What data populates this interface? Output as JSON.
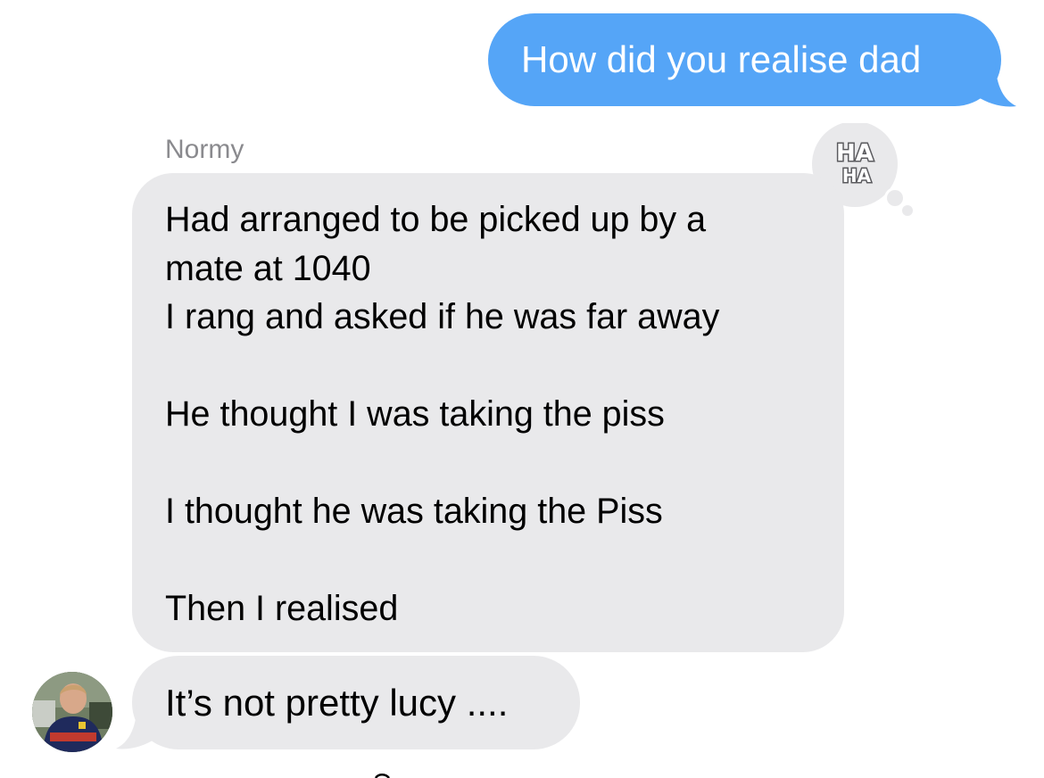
{
  "sent_message": {
    "text": "How did you realise dad"
  },
  "received_group": {
    "sender_name": "Normy",
    "tapback": {
      "icon": "haha-tapback-icon",
      "line1": "HA",
      "line2": "HA"
    },
    "message_1": {
      "lines": [
        "Had arranged to be picked up by a",
        "mate at 1040",
        "I rang and asked if he was far away",
        "",
        "He thought I was taking the piss",
        "",
        "I thought he was taking the Piss",
        "",
        "Then I realised"
      ]
    },
    "message_2": {
      "text": "It’s not pretty lucy ...."
    },
    "avatar": {
      "icon": "contact-avatar-photo"
    }
  },
  "colors": {
    "sent_bubble": "#55a5f7",
    "received_bubble": "#e9e9eb",
    "sender_name": "#8a8a8e",
    "background": "#ffffff"
  }
}
